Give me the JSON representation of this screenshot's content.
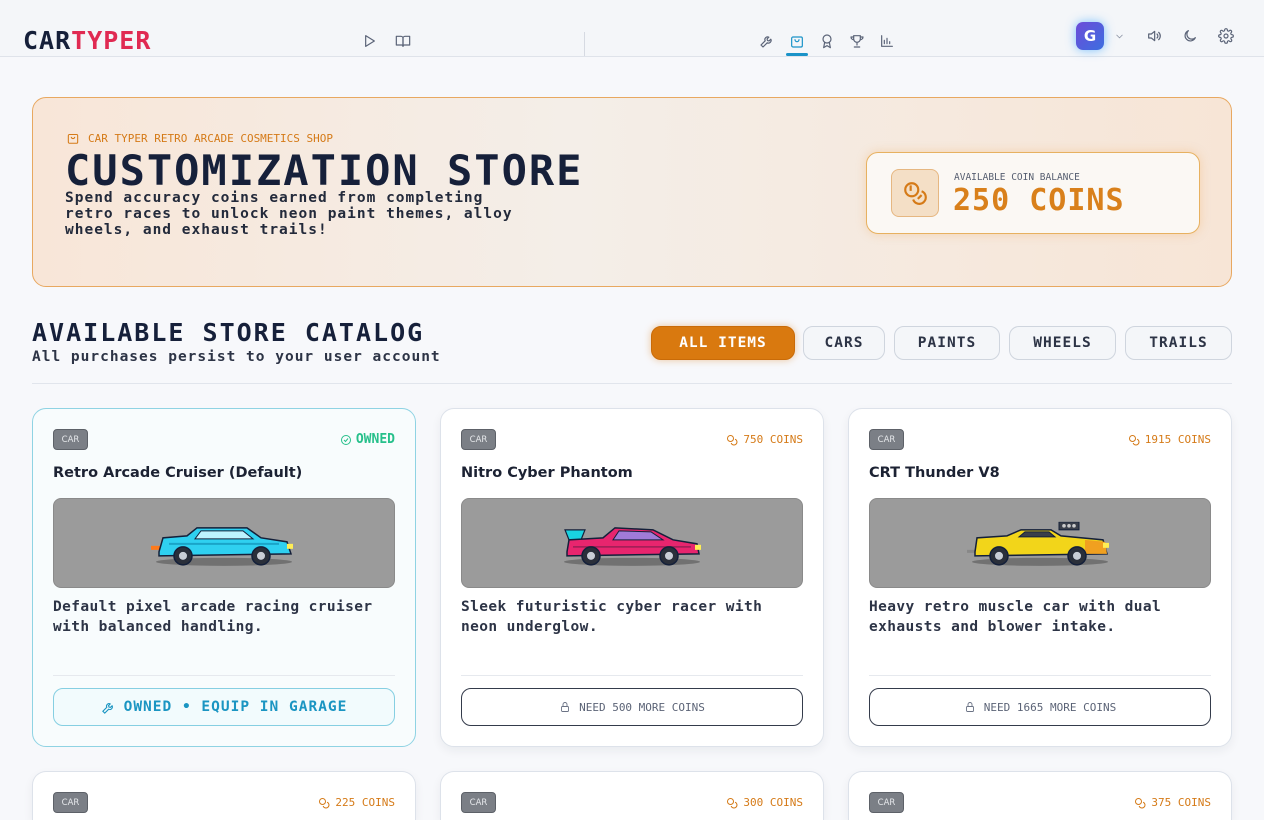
{
  "app": {
    "logo_car": "CAR",
    "logo_typer": "TYPER"
  },
  "nav": {
    "left_icons": [
      "play-icon",
      "book-icon"
    ],
    "center_icons": [
      "wrench-icon",
      "shopping-bag-icon",
      "medal-icon",
      "trophy-icon",
      "bar-chart-icon"
    ],
    "active": "shopping-bag-icon",
    "avatar_initial": "G",
    "right_icons": [
      "chevron-down-icon",
      "volume-icon",
      "moon-icon",
      "gear-icon"
    ]
  },
  "hero": {
    "kicker": "CAR TYPER RETRO ARCADE COSMETICS SHOP",
    "title": "CUSTOMIZATION STORE",
    "description": "Spend accuracy coins earned from completing retro races to unlock neon paint themes, alloy wheels, and exhaust trails!",
    "balance_label": "AVAILABLE COIN BALANCE",
    "balance_value": "250 COINS"
  },
  "catalog": {
    "title": "AVAILABLE STORE CATALOG",
    "subtitle": "All purchases persist to your user account",
    "filters": [
      "ALL ITEMS",
      "CARS",
      "PAINTS",
      "WHEELS",
      "TRAILS"
    ],
    "active_filter": "ALL ITEMS"
  },
  "items": [
    {
      "tag": "CAR",
      "status": "OWNED",
      "name": "Retro Arcade Cruiser (Default)",
      "description": "Default pixel arcade racing cruiser with balanced handling.",
      "action": "OWNED • EQUIP IN GARAGE",
      "body_color": "#2fd0f0"
    },
    {
      "tag": "CAR",
      "price": "750 COINS",
      "name": "Nitro Cyber Phantom",
      "description": "Sleek futuristic cyber racer with neon underglow.",
      "action": "NEED 500 MORE COINS",
      "body_color": "#e8256e"
    },
    {
      "tag": "CAR",
      "price": "1915 COINS",
      "name": "CRT Thunder V8",
      "description": "Heavy retro muscle car with dual exhausts and blower intake.",
      "action": "NEED 1665 MORE COINS",
      "body_color": "#f2d51a"
    },
    {
      "tag": "CAR",
      "price": "225 COINS"
    },
    {
      "tag": "CAR",
      "price": "300 COINS"
    },
    {
      "tag": "CAR",
      "price": "375 COINS"
    }
  ],
  "colors": {
    "accent_orange": "#d9790f",
    "accent_cyan": "#1b95c2",
    "success_green": "#27c08b",
    "logo_red": "#e02a52"
  }
}
